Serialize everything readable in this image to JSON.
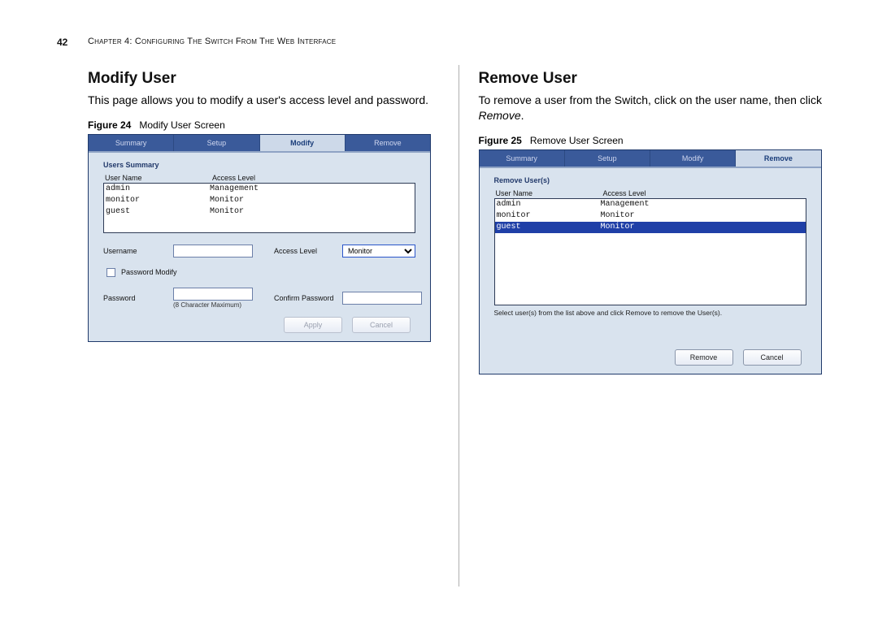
{
  "page_number": "42",
  "chapter_line": "Chapter 4: Configuring The Switch From The Web Interface",
  "left": {
    "title": "Modify User",
    "text": "This page allows you to modify a user's access level and password.",
    "fig_label": "Figure 24",
    "fig_title": "Modify User Screen",
    "tabs": {
      "t0": "Summary",
      "t1": "Setup",
      "t2": "Modify",
      "t3": "Remove"
    },
    "panel_heading": "Users Summary",
    "col_user": "User Name",
    "col_access": "Access Level",
    "rows": [
      {
        "user": "admin",
        "level": "Management"
      },
      {
        "user": "monitor",
        "level": "Monitor"
      },
      {
        "user": "guest",
        "level": "Monitor"
      }
    ],
    "form": {
      "username_label": "Username",
      "access_label": "Access Level",
      "access_value": "Monitor",
      "pwmodify_label": "Password Modify",
      "password_label": "Password",
      "confirm_label": "Confirm Password",
      "charmax": "(8 Character Maximum)",
      "apply": "Apply",
      "cancel": "Cancel"
    }
  },
  "right": {
    "title": "Remove User",
    "text_a": "To remove a user from the Switch, click on the user name, then click ",
    "text_b": "Remove",
    "text_c": ".",
    "fig_label": "Figure 25",
    "fig_title": "Remove User Screen",
    "tabs": {
      "t0": "Summary",
      "t1": "Setup",
      "t2": "Modify",
      "t3": "Remove"
    },
    "panel_heading": "Remove User(s)",
    "col_user": "User Name",
    "col_access": "Access Level",
    "rows": [
      {
        "user": "admin",
        "level": "Management"
      },
      {
        "user": "monitor",
        "level": "Monitor"
      },
      {
        "user": "guest",
        "level": "Monitor"
      }
    ],
    "hint": "Select user(s) from the list above and click Remove to remove the User(s).",
    "remove_btn": "Remove",
    "cancel_btn": "Cancel"
  }
}
